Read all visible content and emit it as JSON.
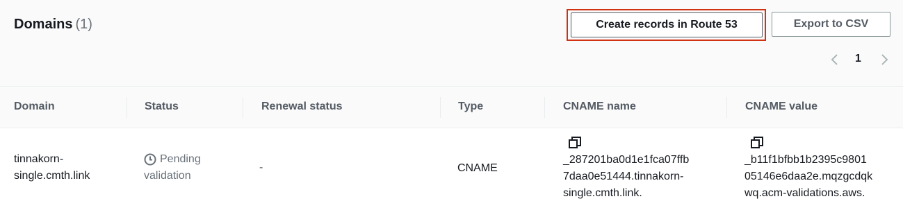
{
  "header": {
    "title": "Domains",
    "count": "(1)",
    "create_records_label": "Create records in Route 53",
    "export_label": "Export to CSV"
  },
  "pagination": {
    "current_page": "1"
  },
  "table": {
    "columns": [
      "Domain",
      "Status",
      "Renewal status",
      "Type",
      "CNAME name",
      "CNAME value"
    ],
    "rows": [
      {
        "domain_line1": "tinnakorn-",
        "domain_line2": "single.cmth.link",
        "status_line1": "Pending",
        "status_line2": "validation",
        "renewal_status": "-",
        "type": "CNAME",
        "cname_name_line1": "_287201ba0d1e1fca07ffb",
        "cname_name_line2": "7daa0e51444.tinnakorn-",
        "cname_name_line3": "single.cmth.link.",
        "cname_value_line1": "_b11f1bfbb1b2395c9801",
        "cname_value_line2": "05146e6daa2e.mqzgcdqk",
        "cname_value_line3": "wq.acm-validations.aws."
      }
    ]
  },
  "icons": {
    "status_icon": "clock-icon",
    "copy_icon": "copy-icon",
    "prev_icon": "chevron-left-icon",
    "next_icon": "chevron-right-icon"
  },
  "colors": {
    "highlight_border": "#d13212",
    "pending_text": "#687078"
  }
}
